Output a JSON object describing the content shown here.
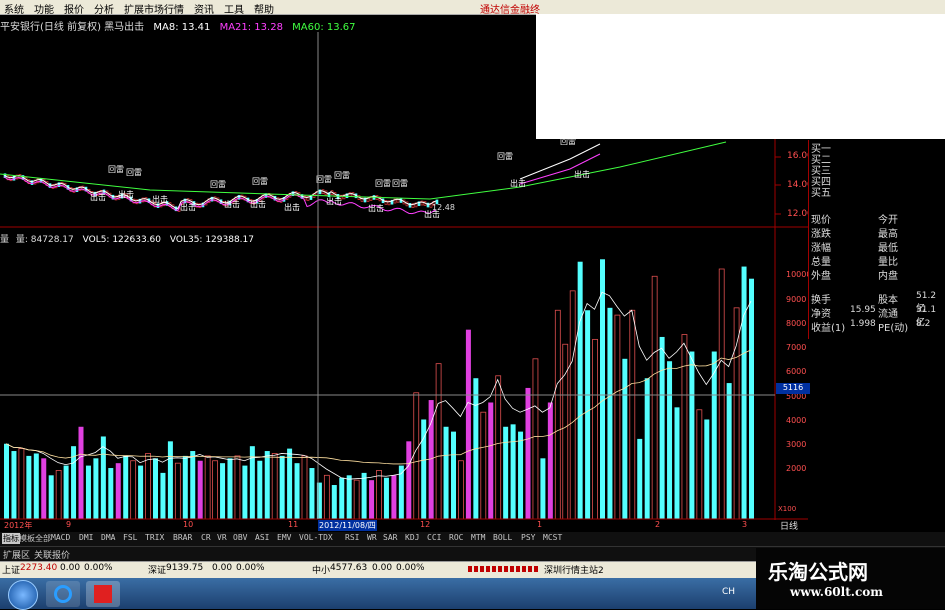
{
  "menu": [
    "系统",
    "功能",
    "报价",
    "分析",
    "扩展市场行情",
    "资讯",
    "工具",
    "帮助"
  ],
  "menu_right": "通达信金融终",
  "title": {
    "stock": "平安银行(日线 前复权) 黑马出击",
    "ma5": "MA8: 13.41",
    "ma21": "MA21: 13.28",
    "ma60": "MA60: 13.67",
    "ma5_color": "#ffffff",
    "ma21_color": "#ff40ff",
    "ma60_color": "#40ff40"
  },
  "price_axis": [
    "16.00",
    "14.00",
    "12.00"
  ],
  "price_low_label": "12.48",
  "signal_labels": {
    "buy": "回雷",
    "sell": "出击"
  },
  "vol_title": {
    "label": "量",
    "vol": "量: 84728.17",
    "vol5": "VOL5: 122633.60",
    "vol35": "VOL35: 129388.17"
  },
  "vol_axis": [
    "10000",
    "9000",
    "8000",
    "7000",
    "6000",
    "5000",
    "4000",
    "3000",
    "2000"
  ],
  "vol_axis_highlight": "5116",
  "vol_axis_unit": "X100",
  "date_axis": [
    "2012年",
    "9",
    "10",
    "11",
    "2012/11/08/四",
    "12",
    "1",
    "2",
    "3"
  ],
  "period_label": "日线",
  "order_book": [
    "买一",
    "买二",
    "买三",
    "买四",
    "买五"
  ],
  "quote_rows": [
    {
      "l": "现价",
      "r": "今开"
    },
    {
      "l": "涨跌",
      "r": "最高"
    },
    {
      "l": "涨幅",
      "r": "最低"
    },
    {
      "l": "总量",
      "r": "量比"
    },
    {
      "l": "外盘",
      "r": "内盘"
    }
  ],
  "fund_rows": [
    {
      "l": "换手",
      "r": "股本",
      "rv": "51.2亿"
    },
    {
      "l": "净资",
      "lv": "15.95",
      "r": "流通",
      "rv": "31.1亿"
    },
    {
      "l": "收益(1)",
      "lv": "1.998",
      "r": "PE(动)",
      "rv": "8.2"
    }
  ],
  "indicator_tabs": [
    "指标",
    "模板",
    "全部",
    "MACD",
    "DMI",
    "DMA",
    "FSL",
    "TRIX",
    "BRAR",
    "CR",
    "VR",
    "OBV",
    "ASI",
    "EMV",
    "VOL-TDX",
    "RSI",
    "WR",
    "SAR",
    "KDJ",
    "CCI",
    "ROC",
    "MTM",
    "BOLL",
    "PSY",
    "MCST"
  ],
  "row2_tabs": [
    "扩展区",
    "关联报价"
  ],
  "status": {
    "sh_label": "上证",
    "sh_val": "2273.40",
    "sh_chg": "0.00",
    "sh_pct": "0.00%",
    "sz_label": "深证",
    "sz_val": "9139.75",
    "sz_chg": "0.00",
    "sz_pct": "0.00%",
    "zx_label": "中小",
    "zx_val": "4577.63",
    "zx_chg": "0.00",
    "zx_pct": "0.00%",
    "server": "深圳行情主站2"
  },
  "taskbar_right": "CH",
  "watermark": {
    "title": "乐淘公式网",
    "url": "www.60lt.com"
  },
  "chart_data": {
    "type": "bar",
    "ylim": [
      0,
      11000
    ],
    "values": [
      3100,
      2800,
      2900,
      2600,
      2700,
      2500,
      1800,
      2000,
      2200,
      3000,
      3800,
      2200,
      2500,
      3400,
      2100,
      2300,
      2600,
      2400,
      2200,
      2700,
      2500,
      1900,
      3200,
      2300,
      2600,
      2800,
      2400,
      2600,
      2400,
      2300,
      2500,
      2600,
      2200,
      3000,
      2400,
      2800,
      2700,
      2600,
      2900,
      2300,
      2600,
      2100,
      1500,
      1800,
      1400,
      1700,
      1800,
      1600,
      1900,
      1600,
      2000,
      1700,
      1800,
      2200,
      3200,
      5200,
      4100,
      4900,
      6400,
      3800,
      3600,
      2400,
      7800,
      5800,
      4400,
      4800,
      5900,
      3800,
      3900,
      3600,
      5400,
      6600,
      2500,
      4800,
      8600,
      7200,
      9400,
      10600,
      8600,
      7400,
      10700,
      8700,
      8400,
      6600,
      8600,
      3300,
      5800,
      10000,
      7500,
      6500,
      4600,
      7600,
      6900,
      4500,
      4100,
      6900,
      10300,
      5600,
      8700,
      10400,
      9900
    ],
    "colors": "c=cyan, m=magenta, r=red outline",
    "color_seq": "ccrccmcrccmccccmcrcrcccrccmrrccrccccrcccrccrcccrcmrcmcmrcmrccrmcrmrcccmrcmrrrccrccrcrccrcccrcrccrcrcc"
  }
}
